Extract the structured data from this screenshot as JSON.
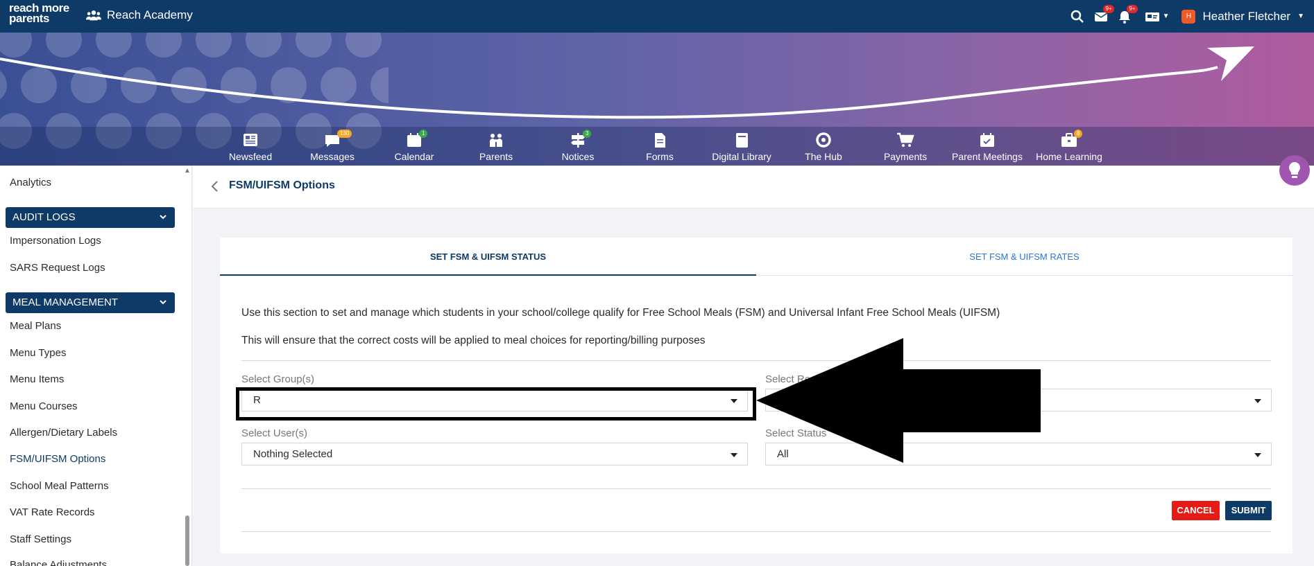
{
  "topbar": {
    "logo_line1": "reach more",
    "logo_line2": "parents",
    "school_name": "Reach Academy",
    "mail_badge": "9+",
    "bell_badge": "9+",
    "user_initial": "H",
    "user_name": "Heather Fletcher"
  },
  "nav": [
    {
      "label": "Newsfeed",
      "icon": "newspaper-icon",
      "badge": ""
    },
    {
      "label": "Messages",
      "icon": "chat-icon",
      "badge": "130"
    },
    {
      "label": "Calendar",
      "icon": "calendar-icon",
      "badge": "1"
    },
    {
      "label": "Parents",
      "icon": "family-icon",
      "badge": ""
    },
    {
      "label": "Notices",
      "icon": "signpost-icon",
      "badge": "3"
    },
    {
      "label": "Forms",
      "icon": "document-icon",
      "badge": ""
    },
    {
      "label": "Digital Library",
      "icon": "book-icon",
      "badge": ""
    },
    {
      "label": "The Hub",
      "icon": "lifebuoy-icon",
      "badge": ""
    },
    {
      "label": "Payments",
      "icon": "cart-icon",
      "badge": ""
    },
    {
      "label": "Parent Meetings",
      "icon": "calendar-check-icon",
      "badge": ""
    },
    {
      "label": "Home Learning",
      "icon": "briefcase-icon",
      "badge": "8"
    }
  ],
  "sidebar": {
    "analytics": "Analytics",
    "audit_logs": "AUDIT LOGS",
    "impersonation_logs": "Impersonation Logs",
    "sars_request_logs": "SARS Request Logs",
    "meal_management": "MEAL MANAGEMENT",
    "meal_plans": "Meal Plans",
    "menu_types": "Menu Types",
    "menu_items": "Menu Items",
    "menu_courses": "Menu Courses",
    "allergen_labels": "Allergen/Dietary Labels",
    "fsm_options": "FSM/UIFSM Options",
    "school_meal_patterns": "School Meal Patterns",
    "vat_rate_records": "VAT Rate Records",
    "staff_settings": "Staff Settings",
    "balance_adjustments": "Balance Adjustments"
  },
  "page": {
    "title": "FSM/UIFSM Options",
    "tab_status": "SET FSM & UIFSM STATUS",
    "tab_rates": "SET FSM & UIFSM RATES",
    "intro1": "Use this section to set and manage which students in your school/college qualify for Free School Meals (FSM) and Universal Infant Free School Meals (UIFSM)",
    "intro2": "This will ensure that the correct costs will be applied to meal choices for reporting/billing purposes",
    "group_label": "Select Group(s)",
    "group_value": "R",
    "relation_label": "Select Re",
    "relation_value": "",
    "user_label": "Select User(s)",
    "user_value": "Nothing Selected",
    "status_label": "Select Status",
    "status_value": "All",
    "cancel": "CANCEL",
    "submit": "SUBMIT"
  },
  "colors": {
    "primary": "#0d3a66",
    "link_blue": "#2a74d8",
    "cancel_red": "#e41b17",
    "badge_orange": "#f5a623",
    "badge_green": "#3aa846"
  }
}
